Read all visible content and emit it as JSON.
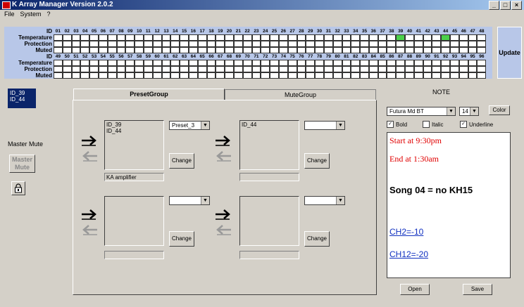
{
  "window": {
    "title": "K Array Manager Version 2.0.2",
    "buttons": [
      "_",
      "□",
      "×"
    ]
  },
  "menu": [
    "File",
    "System",
    "?"
  ],
  "grid": {
    "row_labels_top": [
      "ID",
      "Temperature",
      "Protection",
      "Muted"
    ],
    "row_labels_bottom": [
      "ID",
      "Temperature",
      "Protection",
      "Muted"
    ],
    "ids_top": [
      "01",
      "02",
      "03",
      "04",
      "05",
      "06",
      "07",
      "08",
      "09",
      "10",
      "11",
      "12",
      "13",
      "14",
      "15",
      "16",
      "17",
      "18",
      "19",
      "20",
      "21",
      "22",
      "23",
      "24",
      "25",
      "26",
      "27",
      "28",
      "29",
      "30",
      "31",
      "32",
      "33",
      "34",
      "35",
      "36",
      "37",
      "38",
      "39",
      "40",
      "41",
      "42",
      "43",
      "44",
      "45",
      "46",
      "47",
      "48"
    ],
    "ids_bottom": [
      "49",
      "50",
      "51",
      "52",
      "53",
      "54",
      "55",
      "56",
      "57",
      "58",
      "59",
      "60",
      "61",
      "62",
      "63",
      "64",
      "65",
      "66",
      "67",
      "68",
      "69",
      "70",
      "71",
      "72",
      "73",
      "74",
      "75",
      "76",
      "77",
      "78",
      "79",
      "80",
      "81",
      "82",
      "83",
      "84",
      "85",
      "86",
      "87",
      "88",
      "89",
      "90",
      "91",
      "92",
      "93",
      "94",
      "95",
      "96"
    ],
    "active_temperature_ids": [
      "39",
      "44"
    ],
    "active_color": "#4bd04b"
  },
  "update_label": "Update",
  "selected_ids": [
    "ID_39",
    "ID_44"
  ],
  "master_mute_label": "Master Mute",
  "master_mute_button": "Master\nMute",
  "tabs": [
    "PresetGroup",
    "MuteGroup"
  ],
  "groups": [
    {
      "items": "ID_39\nID_44",
      "preset": "Preset_3",
      "change": "Change",
      "name": "KA amplifier"
    },
    {
      "items": "ID_44",
      "preset": "",
      "change": "Change",
      "name": ""
    },
    {
      "items": "",
      "preset": "",
      "change": "Change",
      "name": ""
    },
    {
      "items": "",
      "preset": "",
      "change": "Change",
      "name": ""
    }
  ],
  "note": {
    "title": "NOTE",
    "font": "Futura Md BT",
    "size": "14",
    "color_button": "Color",
    "bold_label": "Bold",
    "italic_label": "Italic",
    "underline_label": "Underline",
    "bold_checked": true,
    "italic_checked": false,
    "underline_checked": true,
    "lines": [
      {
        "text": "Start at 9:30pm",
        "color": "#e00000"
      },
      {
        "text": "End at 1:30am",
        "color": "#e00000"
      },
      {
        "text": "Song 04 = no KH15",
        "color": "#000000"
      },
      {
        "text": "CH2=-10",
        "color": "#1030c0"
      },
      {
        "text": "CH12=-20",
        "color": "#1030c0"
      }
    ],
    "open_label": "Open",
    "save_label": "Save"
  }
}
